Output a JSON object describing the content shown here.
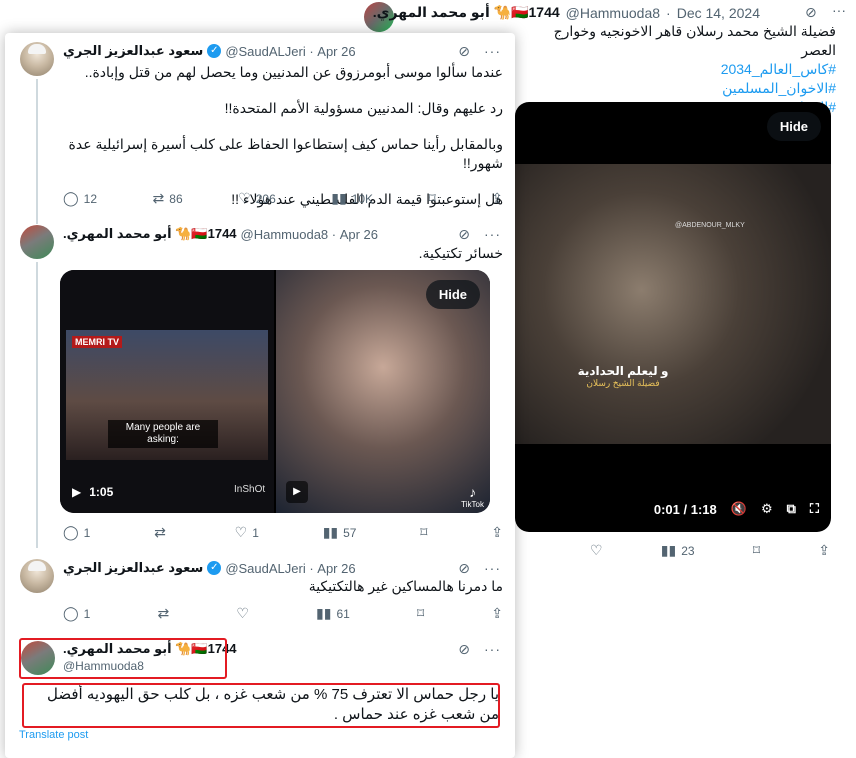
{
  "background_tweet": {
    "name": ".أبو محمد المهري 🐪🇴🇲1744",
    "handle": "@Hammuoda8",
    "date": "Dec 14, 2024",
    "text": "فضيلة الشيخ محمد رسلان قاهر الاخونجيه وخوارج العصر",
    "hashtags": [
      "#كاس_العالم_2034",
      "#الاخوان_المسلمين",
      "#الخوارج"
    ],
    "video": {
      "hide_label": "Hide",
      "overlay_caption": "و ليعلم الحدادية",
      "sub_caption": "فضيلة الشيخ رسلان",
      "watermark": "@ABDENOUR_MLKY",
      "time": "0:01 / 1:18"
    },
    "actions": {
      "likes": "",
      "retweets": "23"
    }
  },
  "thread": [
    {
      "name": "سعود عبدالعزيز الجري",
      "handle": "@SaudALJeri",
      "date": "Apr 26",
      "paragraphs": [
        "عندما سألوا موسى أبومرزوق عن المدنيين وما يحصل لهم من قتل وإبادة..",
        "رد عليهم وقال: المدنيين مسؤولية الأمم المتحدة!!",
        "وبالمقابل رأينا حماس كيف إستطاعوا الحفاظ على كلب أسيرة إسرائيلية عدة شهور!!",
        "هل إستوعبتوا قيمة الدم الفلسطيني عند هؤلاء !!"
      ],
      "actions": {
        "reply": "12",
        "retweet": "86",
        "like": "206",
        "views": "10K"
      }
    },
    {
      "name": ".أبو محمد المهري 🐪🇴🇲1744",
      "handle": "@Hammuoda8",
      "date": "Apr 26",
      "text": "خسائر تكتيكية.",
      "media": {
        "left_time": "1:05",
        "left_tv_label": "MEMRI TV",
        "left_caption": "Many people are asking:",
        "left_watermark": "InShOt",
        "right_hide": "Hide",
        "right_tiktok": "TikTok"
      },
      "actions": {
        "reply": "1",
        "retweet": "",
        "like": "1",
        "views": "57"
      }
    },
    {
      "name": "سعود عبدالعزيز الجري",
      "handle": "@SaudALJeri",
      "date": "Apr 26",
      "text": "ما دمرنا هالمساكين غير هالتكتيكية",
      "actions": {
        "reply": "1",
        "retweet": "",
        "like": "",
        "views": "61"
      }
    }
  ],
  "focus_tweet": {
    "name": ".أبو محمد المهري 🐪🇴🇲1744",
    "handle": "@Hammuoda8",
    "text": "يا رجل حماس الا تعترف 75 % من شعب غزه ، بل كلب حق اليهوديه أفضل من شعب غزه  عند حماس .",
    "translate": "Translate post"
  }
}
